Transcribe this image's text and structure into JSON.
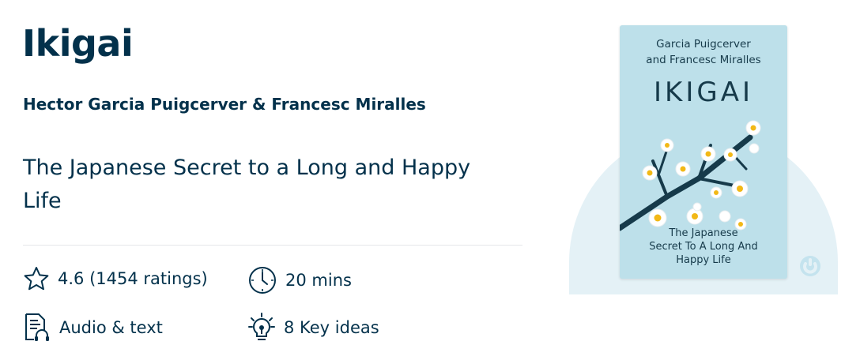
{
  "book": {
    "title": "Ikigai",
    "authors": "Hector Garcia Puigcerver & Francesc Miralles",
    "subtitle": "The Japanese Secret to a Long and Happy Life"
  },
  "meta": {
    "rating": "4.6 (1454 ratings)",
    "duration": "20 mins",
    "format": "Audio & text",
    "key_ideas": "8 Key ideas"
  },
  "cover": {
    "authors_line1": "Garcia Puigcerver",
    "authors_line2": "and Francesc Miralles",
    "title": "IKIGAI",
    "tagline_line1": "The Japanese",
    "tagline_line2": "Secret To A Long And",
    "tagline_line3": "Happy Life"
  },
  "icons": [
    "star-icon",
    "clock-icon",
    "document-audio-icon",
    "lightbulb-icon",
    "brand-badge-icon",
    "blossom-branch-illustration"
  ],
  "colors": {
    "text": "#03314b",
    "cover": "#bde0ea",
    "arc": "#e4f1f6",
    "divider": "#e5e7e9"
  }
}
